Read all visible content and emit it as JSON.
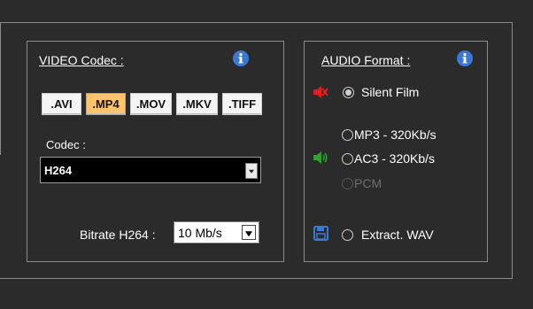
{
  "video": {
    "title": "VIDEO Codec :",
    "formats": [
      {
        "label": ".AVI",
        "selected": false
      },
      {
        "label": ".MP4",
        "selected": true
      },
      {
        "label": ".MOV",
        "selected": false
      },
      {
        "label": ".MKV",
        "selected": false
      },
      {
        "label": ".TIFF",
        "selected": false
      }
    ],
    "codec_label": "Codec :",
    "codec_value": "H264",
    "bitrate_label": "Bitrate H264 :",
    "bitrate_value": "10 Mb/s"
  },
  "audio": {
    "title": "AUDIO Format :",
    "silent_film": "Silent Film",
    "mp3": "MP3 - 320Kb/s",
    "ac3": "AC3 - 320Kb/s",
    "pcm": "PCM",
    "extract_wav": "Extract. WAV"
  },
  "colors": {
    "background": "#2b2b2b",
    "info_icon": "#3a78d8",
    "selected_format": "#ffc36b",
    "mute_icon": "#e02020",
    "speaker_icon": "#2fa12f",
    "save_icon": "#3a78d8"
  },
  "icons": {
    "info": "info-icon",
    "mute": "speaker-muted-icon",
    "speaker": "speaker-icon",
    "save": "floppy-disk-icon"
  }
}
